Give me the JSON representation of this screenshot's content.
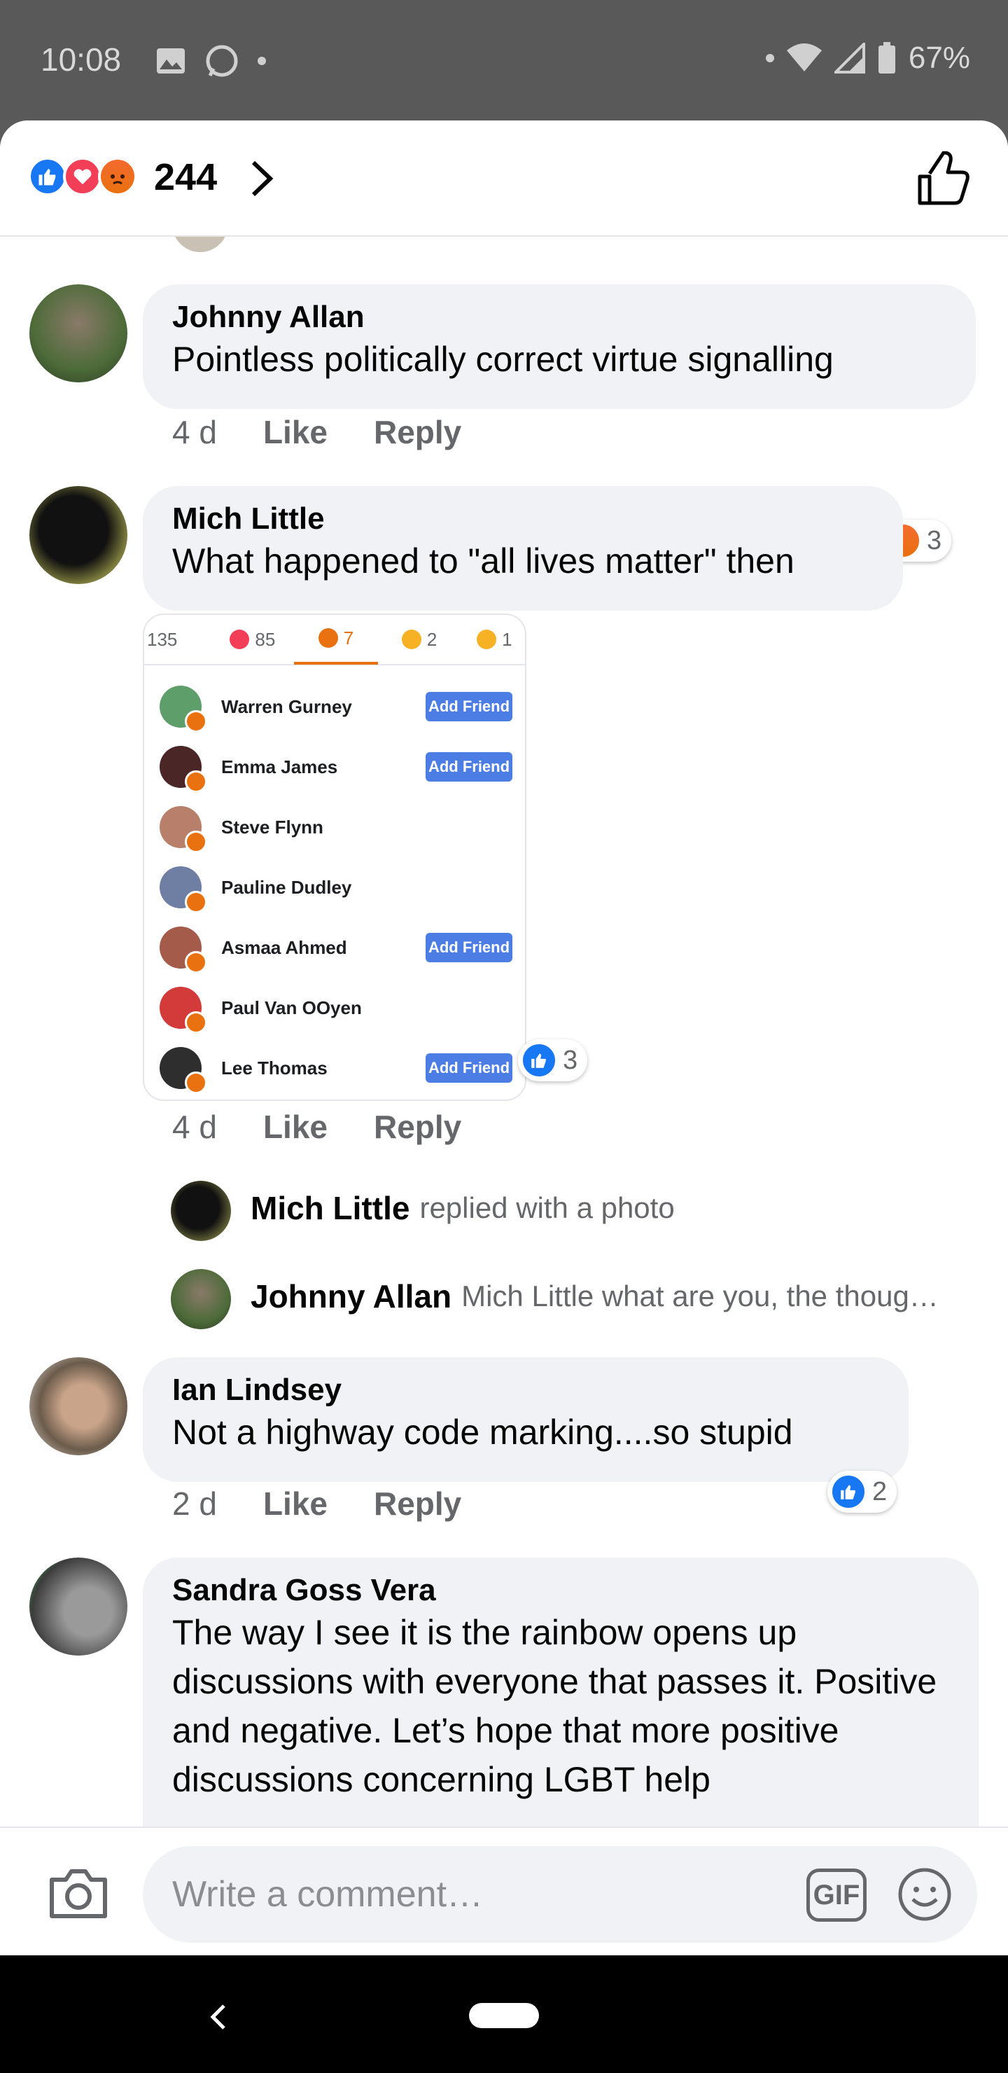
{
  "status_bar": {
    "time": "10:08",
    "battery": "67%"
  },
  "header": {
    "reaction_count": "244"
  },
  "comments": [
    {
      "name": "Johnny Allan",
      "text": "Pointless politically correct virtue signalling",
      "time": "4 d",
      "like": "Like",
      "reply": "Reply",
      "reaction_count": "3"
    },
    {
      "name": "Mich Little",
      "text": "What happened to \"all lives matter\" then",
      "time": "4 d",
      "like": "Like",
      "reply": "Reply",
      "reaction_count": "3"
    },
    {
      "name": "Ian Lindsey",
      "text": "Not a highway code marking....so stupid",
      "time": "2 d",
      "like": "Like",
      "reply": "Reply",
      "reaction_count": "2"
    },
    {
      "name": "Sandra Goss Vera",
      "text": "The way I see it is the rainbow opens up discussions with everyone that passes it. Positive and negative. Let’s hope that more positive discussions concerning LGBT help"
    }
  ],
  "photo": {
    "tabs": [
      {
        "count": "135"
      },
      {
        "count": "85"
      },
      {
        "count": "7"
      },
      {
        "count": "2"
      },
      {
        "count": "1"
      }
    ],
    "rows": [
      {
        "name": "Warren Gurney",
        "button": "Add Friend"
      },
      {
        "name": "Emma James",
        "button": "Add Friend"
      },
      {
        "name": "Steve Flynn",
        "button": ""
      },
      {
        "name": "Pauline Dudley",
        "button": ""
      },
      {
        "name": "Asmaa Ahmed",
        "button": "Add Friend"
      },
      {
        "name": "Paul Van OOyen",
        "button": ""
      },
      {
        "name": "Lee Thomas",
        "button": "Add Friend"
      }
    ]
  },
  "replies": [
    {
      "name": "Mich Little",
      "text": "replied with a photo"
    },
    {
      "name": "Johnny Allan",
      "text": "Mich Little what are you, the thoug…"
    }
  ],
  "composer": {
    "placeholder": "Write a comment…",
    "gif": "GIF"
  }
}
